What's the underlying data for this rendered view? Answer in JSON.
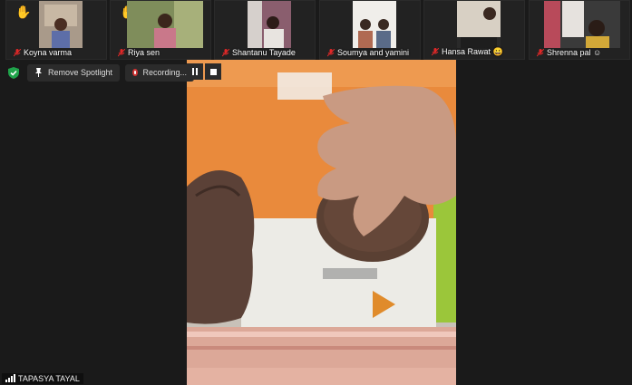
{
  "participants": [
    {
      "name": "Koyna varma",
      "hand_raised": true
    },
    {
      "name": "Riya sen",
      "hand_raised": true
    },
    {
      "name": "Shantanu Tayade",
      "hand_raised": false
    },
    {
      "name": "Soumya and yamini",
      "hand_raised": false
    },
    {
      "name": "Hansa Rawat 😀",
      "hand_raised": false
    },
    {
      "name": "Shrenna pal ☺",
      "hand_raised": false
    }
  ],
  "toolbar": {
    "remove_spotlight": "Remove Spotlight",
    "recording": "Recording...",
    "pause_icon": "pause-icon",
    "stop_icon": "stop-icon"
  },
  "main_video": {
    "speaker_name": "TAPASYA TAYAL"
  },
  "colors": {
    "background": "#1a1a1a",
    "mute_red": "#e02828",
    "shield_green": "#1fa34a",
    "hand_yellow": "#f5c518"
  }
}
